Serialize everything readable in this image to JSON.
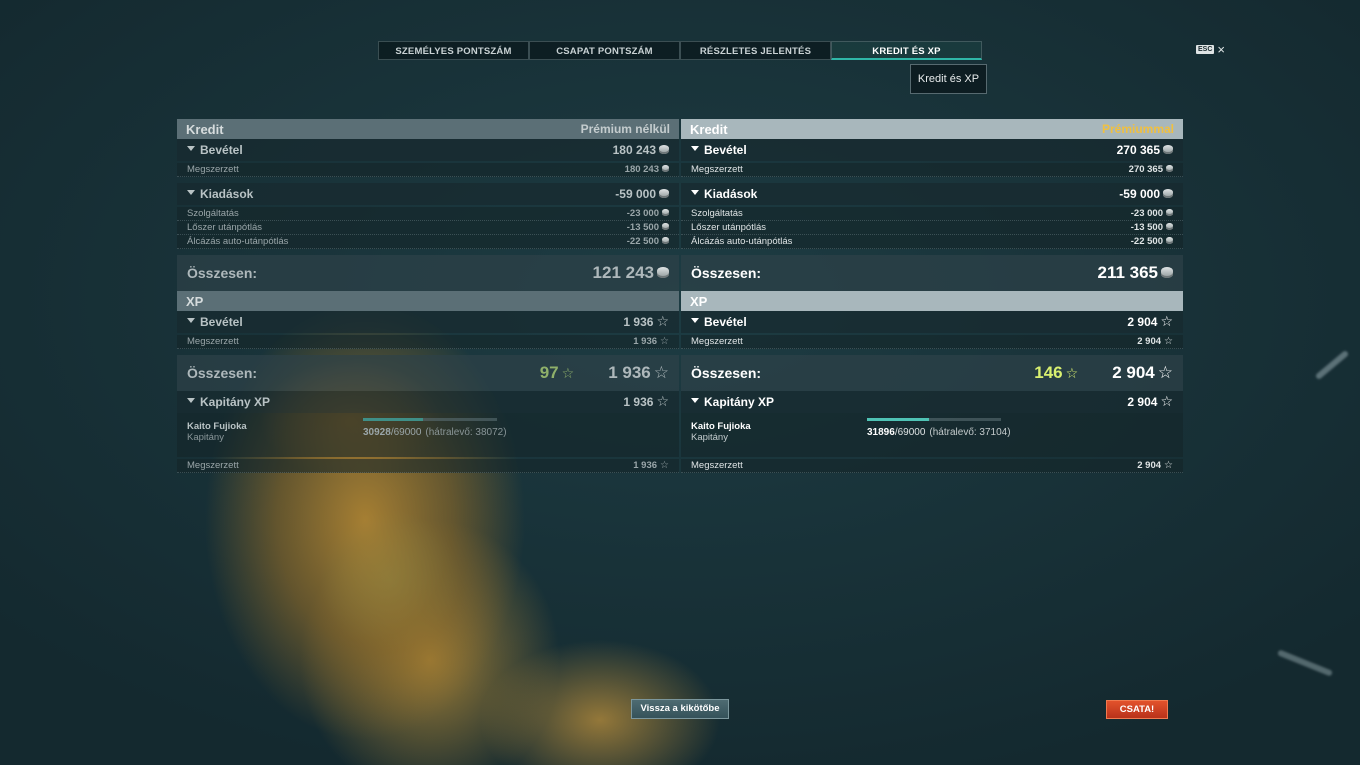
{
  "tabs": [
    {
      "label": "SZEMÉLYES PONTSZÁM",
      "active": false
    },
    {
      "label": "CSAPAT PONTSZÁM",
      "active": false
    },
    {
      "label": "RÉSZLETES JELENTÉS",
      "active": false
    },
    {
      "label": "KREDIT ÉS XP",
      "active": true
    }
  ],
  "tooltip": "Kredit és XP",
  "esc_label": "ESC",
  "close_glyph": "×",
  "left": {
    "credit_title": "Kredit",
    "credit_subtitle": "Prémium nélkül",
    "income_label": "Bevétel",
    "income_value": "180 243",
    "income_items": [
      {
        "label": "Megszerzett",
        "value": "180 243"
      }
    ],
    "expenses_label": "Kiadások",
    "expenses_value": "-59 000",
    "expense_items": [
      {
        "label": "Szolgáltatás",
        "value": "-23 000"
      },
      {
        "label": "Lőszer utánpótlás",
        "value": "-13 500"
      },
      {
        "label": "Álcázás auto-utánpótlás",
        "value": "-22 500"
      }
    ],
    "credit_total_label": "Összesen:",
    "credit_total": "121 243",
    "xp_title": "XP",
    "xp_income_label": "Bevétel",
    "xp_income_value": "1 936",
    "xp_items": [
      {
        "label": "Megszerzett",
        "value": "1 936"
      }
    ],
    "xp_total_label": "Összesen:",
    "xp_bonus": "97",
    "xp_total": "1 936",
    "captain_label": "Kapitány XP",
    "captain_value": "1 936",
    "captain_name": "Kaito Fujioka",
    "captain_rank": "Kapitány",
    "captain_progress": "30928",
    "captain_progress_max": "/69000",
    "captain_remaining": "(hátralevő: 38072)",
    "captain_progress_fraction": 0.448,
    "captain_earned_label": "Megszerzett",
    "captain_earned_value": "1 936"
  },
  "right": {
    "credit_title": "Kredit",
    "credit_subtitle": "Prémiummal",
    "income_label": "Bevétel",
    "income_value": "270 365",
    "income_items": [
      {
        "label": "Megszerzett",
        "value": "270 365"
      }
    ],
    "expenses_label": "Kiadások",
    "expenses_value": "-59 000",
    "expense_items": [
      {
        "label": "Szolgáltatás",
        "value": "-23 000"
      },
      {
        "label": "Lőszer utánpótlás",
        "value": "-13 500"
      },
      {
        "label": "Álcázás auto-utánpótlás",
        "value": "-22 500"
      }
    ],
    "credit_total_label": "Összesen:",
    "credit_total": "211 365",
    "xp_title": "XP",
    "xp_income_label": "Bevétel",
    "xp_income_value": "2 904",
    "xp_items": [
      {
        "label": "Megszerzett",
        "value": "2 904"
      }
    ],
    "xp_total_label": "Összesen:",
    "xp_bonus": "146",
    "xp_total": "2 904",
    "captain_label": "Kapitány XP",
    "captain_value": "2 904",
    "captain_name": "Kaito Fujioka",
    "captain_rank": "Kapitány",
    "captain_progress": "31896",
    "captain_progress_max": "/69000",
    "captain_remaining": "(hátralevő: 37104)",
    "captain_progress_fraction": 0.462,
    "captain_earned_label": "Megszerzett",
    "captain_earned_value": "2 904"
  },
  "buttons": {
    "back": "Vissza a kikötőbe",
    "battle": "CSATA!"
  },
  "icons": {
    "credit": "credit-coin-icon",
    "xp": "star-icon"
  },
  "colors": {
    "premium_label": "#f0c040",
    "battle_button": "#d8441f",
    "active_tab_accent": "#2fb7a8"
  }
}
